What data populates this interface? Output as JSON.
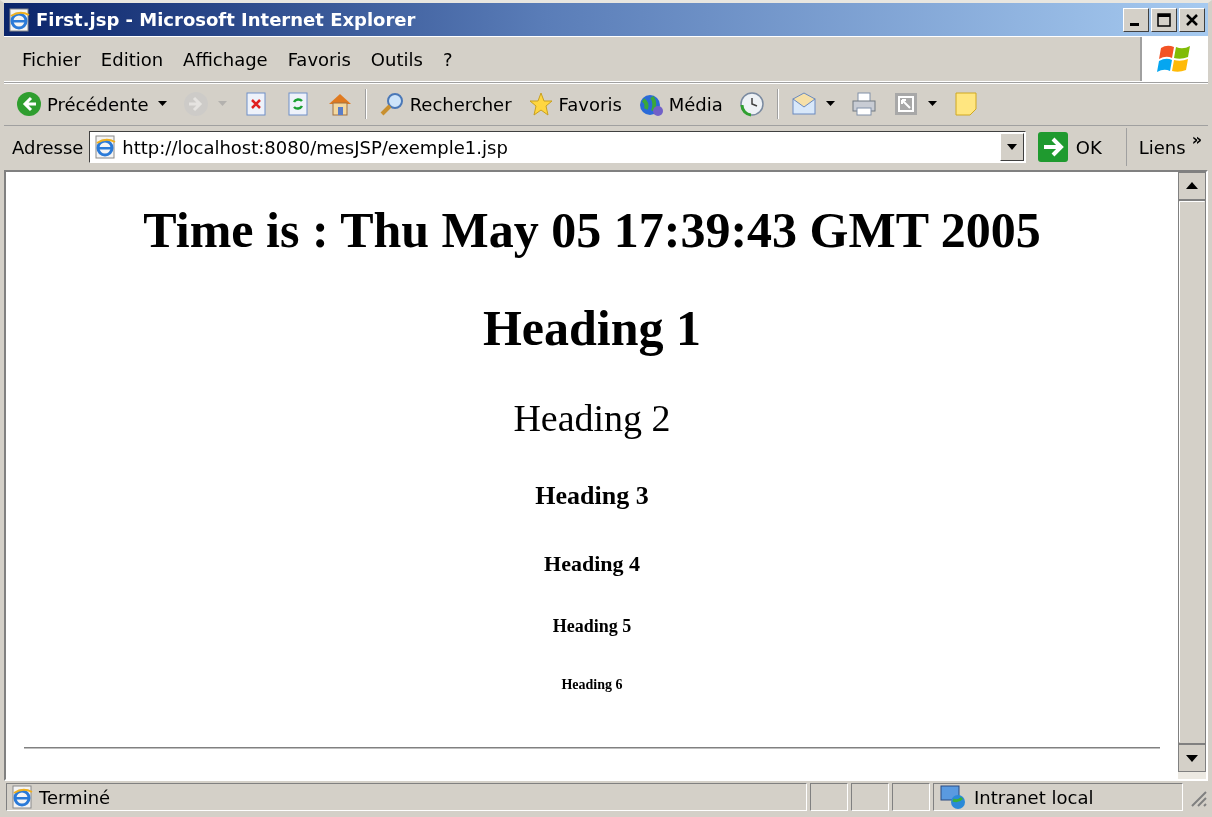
{
  "window": {
    "title": "First.jsp - Microsoft Internet Explorer"
  },
  "menu": [
    "Fichier",
    "Edition",
    "Affichage",
    "Favoris",
    "Outils",
    "?"
  ],
  "toolbar": [
    {
      "kind": "back",
      "label": "Précédente",
      "dropdown": true,
      "disabled": false
    },
    {
      "kind": "forward",
      "dropdown": true,
      "disabled": true
    },
    {
      "kind": "stop",
      "dropdown": false,
      "disabled": false
    },
    {
      "kind": "refresh",
      "dropdown": false,
      "disabled": false
    },
    {
      "kind": "home",
      "dropdown": false,
      "disabled": false
    },
    {
      "kind": "separator"
    },
    {
      "kind": "search",
      "label": "Rechercher",
      "dropdown": false,
      "disabled": false
    },
    {
      "kind": "favorites",
      "label": "Favoris",
      "dropdown": false,
      "disabled": false
    },
    {
      "kind": "media",
      "label": "Média",
      "dropdown": false,
      "disabled": false
    },
    {
      "kind": "history",
      "dropdown": false,
      "disabled": false
    },
    {
      "kind": "separator"
    },
    {
      "kind": "mail",
      "dropdown": true,
      "disabled": false
    },
    {
      "kind": "print",
      "dropdown": false,
      "disabled": false
    },
    {
      "kind": "fullscreen",
      "dropdown": true,
      "disabled": false
    },
    {
      "kind": "note",
      "dropdown": false,
      "disabled": false
    }
  ],
  "address": {
    "label": "Adresse",
    "value": "http://localhost:8080/mesJSP/exemple1.jsp",
    "go_label": "OK",
    "links_label": "Liens",
    "links_more": "»"
  },
  "page": {
    "headings": [
      {
        "kind": "h1",
        "text": "Time is : Thu May 05 17:39:43 GMT 2005"
      },
      {
        "kind": "h1",
        "text": "Heading 1"
      },
      {
        "kind": "h2",
        "text": "Heading 2"
      },
      {
        "kind": "h3",
        "text": "Heading 3"
      },
      {
        "kind": "h4",
        "text": "Heading 4"
      },
      {
        "kind": "h5",
        "text": "Heading 5"
      },
      {
        "kind": "h6",
        "text": "Heading 6"
      }
    ]
  },
  "status_bar": {
    "text": "Terminé",
    "zone": "Intranet local"
  }
}
